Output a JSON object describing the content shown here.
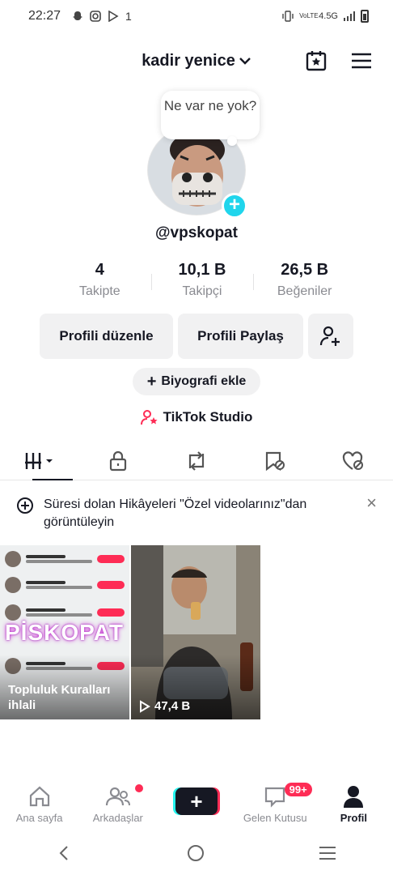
{
  "status_bar": {
    "time": "22:27",
    "app_icons": [
      "snapchat-icon",
      "instagram-icon",
      "play-icon"
    ],
    "notif_count": "1",
    "network": "4.5G",
    "volte": "VoLTE"
  },
  "header": {
    "username": "kadir yenice",
    "calendar_icon": "calendar-star-icon",
    "menu_icon": "hamburger-menu-icon"
  },
  "bubble": {
    "text": "Ne var ne yok?"
  },
  "profile": {
    "handle": "@vpskopat"
  },
  "stats": [
    {
      "value": "4",
      "label": "Takipte"
    },
    {
      "value": "10,1 B",
      "label": "Takipçi"
    },
    {
      "value": "26,5 B",
      "label": "Beğeniler"
    }
  ],
  "actions": {
    "edit": "Profili düzenle",
    "share": "Profili Paylaş",
    "bio": "Biyografi ekle",
    "studio": "TikTok Studio"
  },
  "notice": {
    "text": "Süresi dolan Hikâyeleri \"Özel videolarınız\"dan görüntüleyin"
  },
  "videos": [
    {
      "overlay_title": "PİSKOPAT",
      "caption": "Topluluk Kuralları ihlali"
    },
    {
      "views": "47,4 B"
    }
  ],
  "bottom_nav": {
    "home": "Ana sayfa",
    "friends": "Arkadaşlar",
    "inbox": "Gelen Kutusu",
    "inbox_badge": "99+",
    "profile": "Profil"
  },
  "colors": {
    "accent": "#fe2c55",
    "cyan": "#20d5ec"
  }
}
